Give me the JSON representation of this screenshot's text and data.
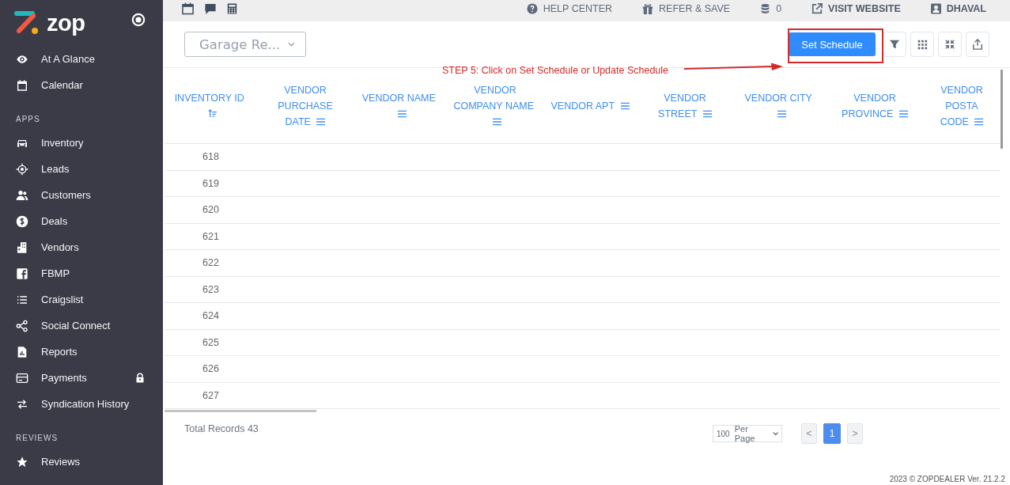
{
  "sidebar": {
    "logo": "zop",
    "items": [
      {
        "label": "At A Glance",
        "locked": false
      },
      {
        "label": "Calendar",
        "locked": false
      }
    ],
    "sections": [
      {
        "title": "APPS",
        "items": [
          {
            "label": "Inventory",
            "locked": false
          },
          {
            "label": "Leads",
            "locked": false
          },
          {
            "label": "Customers",
            "locked": false
          },
          {
            "label": "Deals",
            "locked": false
          },
          {
            "label": "Vendors",
            "locked": false
          },
          {
            "label": "FBMP",
            "locked": false
          },
          {
            "label": "Craigslist",
            "locked": false
          },
          {
            "label": "Social Connect",
            "locked": false
          },
          {
            "label": "Reports",
            "locked": false
          },
          {
            "label": "Payments",
            "locked": true
          },
          {
            "label": "Syndication History",
            "locked": false
          }
        ]
      },
      {
        "title": "REVIEWS",
        "items": [
          {
            "label": "Reviews",
            "locked": false
          }
        ]
      }
    ]
  },
  "topbar": {
    "links": [
      {
        "label": "HELP CENTER"
      },
      {
        "label": "REFER & SAVE"
      },
      {
        "label": "0"
      },
      {
        "label": "VISIT WEBSITE"
      },
      {
        "label": "DHAVAL"
      }
    ]
  },
  "toolbar": {
    "dropdown": "Garage Re...",
    "primary_button": "Set Schedule"
  },
  "annotation": {
    "text": "STEP 5: Click on Set Schedule or Update Schedule"
  },
  "table": {
    "columns": [
      {
        "label": "INVENTORY ID",
        "sorted": true
      },
      {
        "label": "VENDOR PURCHASE DATE",
        "sorted": false
      },
      {
        "label": "VENDOR NAME",
        "sorted": false
      },
      {
        "label": "VENDOR COMPANY NAME",
        "sorted": false
      },
      {
        "label": "VENDOR APT",
        "sorted": false
      },
      {
        "label": "VENDOR STREET",
        "sorted": false
      },
      {
        "label": "VENDOR CITY",
        "sorted": false
      },
      {
        "label": "VENDOR PROVINCE",
        "sorted": false
      },
      {
        "label": "VENDOR POSTA CODE",
        "sorted": false
      }
    ],
    "rows": [
      {
        "inventory_id": "618"
      },
      {
        "inventory_id": "619"
      },
      {
        "inventory_id": "620"
      },
      {
        "inventory_id": "621"
      },
      {
        "inventory_id": "622"
      },
      {
        "inventory_id": "623"
      },
      {
        "inventory_id": "624"
      },
      {
        "inventory_id": "625"
      },
      {
        "inventory_id": "626"
      },
      {
        "inventory_id": "627"
      }
    ]
  },
  "footer": {
    "total": "Total Records 43",
    "page_size": "100",
    "page_size_label": "Per Page",
    "prev": "<",
    "next": ">",
    "pages": [
      {
        "label": "1",
        "selected": true
      }
    ],
    "copyright": "2023 © ZOPDEALER Ver. 21.2.2"
  }
}
